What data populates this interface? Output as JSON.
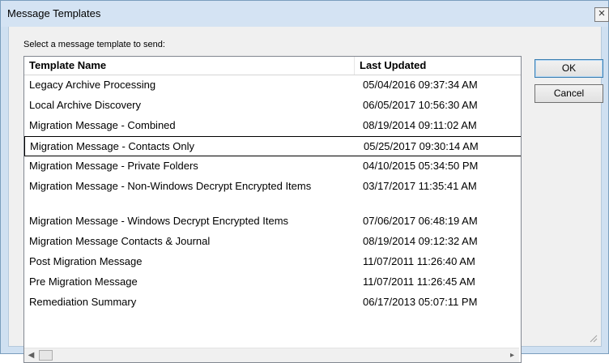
{
  "window": {
    "title": "Message Templates",
    "close_glyph": "×"
  },
  "prompt": "Select a message template to send:",
  "columns": {
    "name": "Template Name",
    "updated": "Last Updated"
  },
  "rows": [
    {
      "name": "Legacy Archive Processing",
      "updated": "05/04/2016 09:37:34 AM"
    },
    {
      "name": "Local Archive Discovery",
      "updated": "06/05/2017 10:56:30 AM"
    },
    {
      "name": "Migration Message - Combined",
      "updated": "08/19/2014 09:11:02 AM"
    },
    {
      "name": "Migration Message - Contacts Only",
      "updated": "05/25/2017 09:30:14 AM"
    },
    {
      "name": "Migration Message - Private Folders",
      "updated": "04/10/2015 05:34:50 PM"
    },
    {
      "name": "Migration Message - Non-Windows Decrypt Encrypted Items",
      "updated": "03/17/2017 11:35:41 AM"
    },
    {
      "name": "Migration Message - Windows Decrypt Encrypted Items",
      "updated": "07/06/2017 06:48:19 AM"
    },
    {
      "name": "Migration Message Contacts & Journal",
      "updated": "08/19/2014 09:12:32 AM"
    },
    {
      "name": "Post Migration Message",
      "updated": "11/07/2011 11:26:40 AM"
    },
    {
      "name": "Pre Migration Message",
      "updated": "11/07/2011 11:26:45 AM"
    },
    {
      "name": "Remediation Summary",
      "updated": "06/17/2013 05:07:11 PM"
    }
  ],
  "focused_row": 3,
  "buttons": {
    "ok": "OK",
    "cancel": "Cancel"
  },
  "scrollbar": {
    "left_arrow": "◀",
    "right_arrow": "▸"
  },
  "icons": {
    "close": "close-icon",
    "scroll_left": "arrow-left-icon",
    "scroll_right": "arrow-right-icon",
    "resize": "resize-grip-icon"
  }
}
